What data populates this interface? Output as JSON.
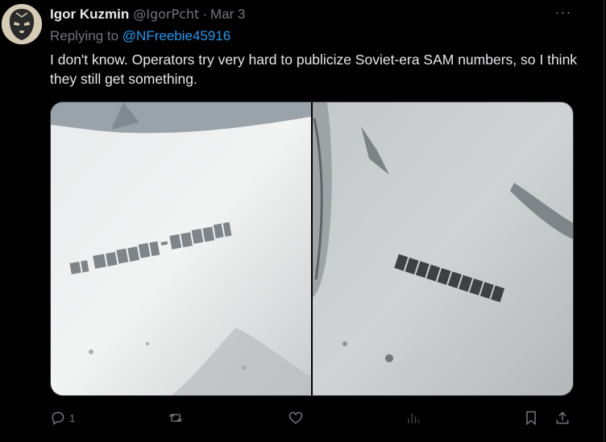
{
  "tweet": {
    "author_name": "Igor Kuzmin",
    "author_handle": "@IgorPcht",
    "separator": "·",
    "date": "Mar 3",
    "more_label": "···",
    "replying_prefix": "Replying to ",
    "replying_to": "@NFreebie45916",
    "text": "I don't know. Operators try very hard to publicize Soviet-era SAM numbers, so I think they still get something.",
    "media": [
      {
        "description_icon": "photo-sam-serial-left"
      },
      {
        "description_icon": "photo-sam-serial-right"
      }
    ],
    "actions": {
      "reply_count": "1",
      "retweet_count": "",
      "like_count": "",
      "views_count": ""
    }
  },
  "colors": {
    "background": "#000000",
    "text": "#e7e9ea",
    "muted": "#71767b",
    "link": "#1d9bf0",
    "border": "#2f3336"
  }
}
